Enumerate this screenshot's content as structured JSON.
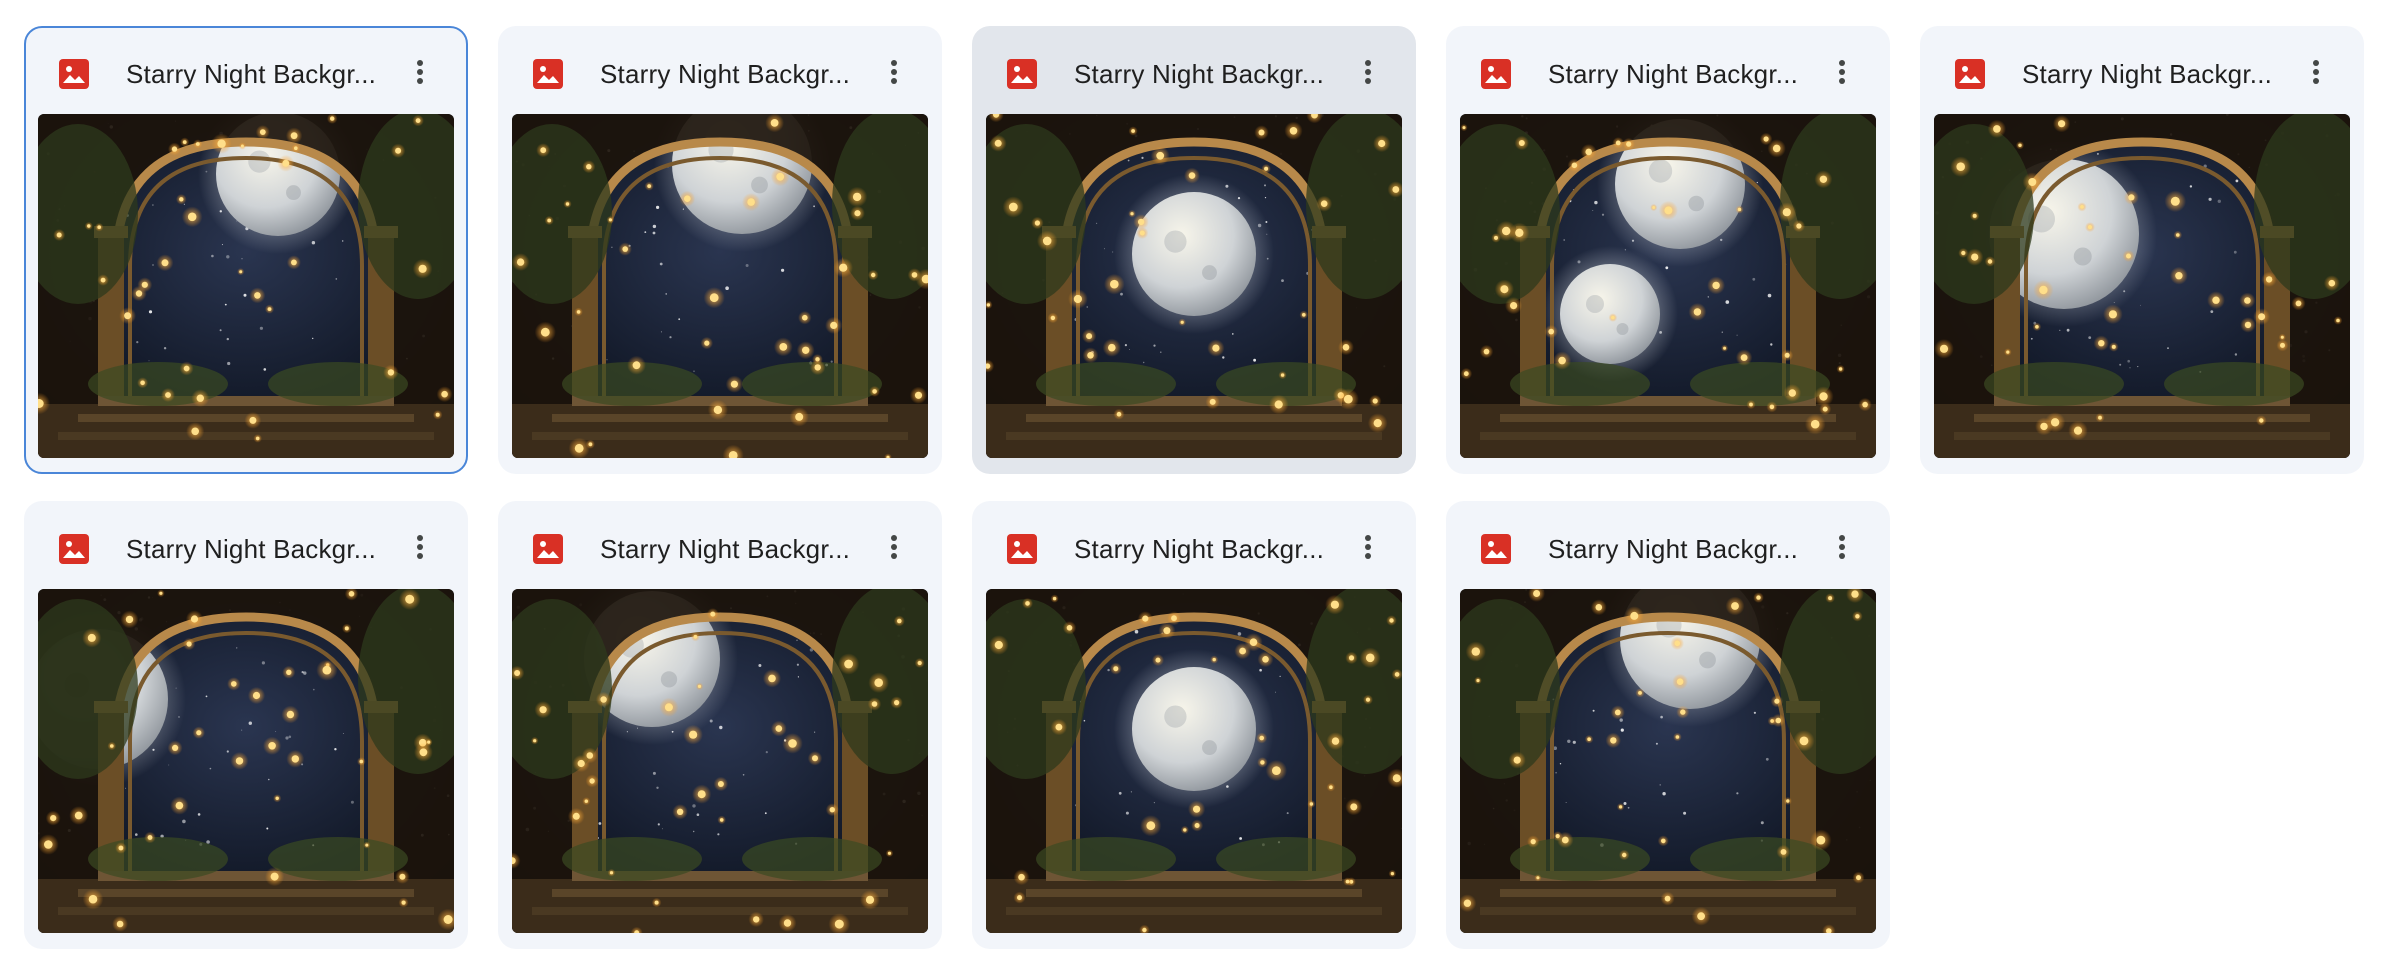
{
  "files": [
    {
      "title": "Starry Night Backgr...",
      "file_type_icon": "image-icon",
      "menu_icon": "more-vert-icon",
      "state": "selected",
      "moon": "upper-center"
    },
    {
      "title": "Starry Night Backgr...",
      "file_type_icon": "image-icon",
      "menu_icon": "more-vert-icon",
      "state": "normal",
      "moon": "upper-right"
    },
    {
      "title": "Starry Night Backgr...",
      "file_type_icon": "image-icon",
      "menu_icon": "more-vert-icon",
      "state": "hovered",
      "moon": "center"
    },
    {
      "title": "Starry Night Backgr...",
      "file_type_icon": "image-icon",
      "menu_icon": "more-vert-icon",
      "state": "normal",
      "moon": "two-moons"
    },
    {
      "title": "Starry Night Backgr...",
      "file_type_icon": "image-icon",
      "menu_icon": "more-vert-icon",
      "state": "normal",
      "moon": "center-left"
    },
    {
      "title": "Starry Night Backgr...",
      "file_type_icon": "image-icon",
      "menu_icon": "more-vert-icon",
      "state": "normal",
      "moon": "left"
    },
    {
      "title": "Starry Night Backgr...",
      "file_type_icon": "image-icon",
      "menu_icon": "more-vert-icon",
      "state": "normal",
      "moon": "upper-left"
    },
    {
      "title": "Starry Night Backgr...",
      "file_type_icon": "image-icon",
      "menu_icon": "more-vert-icon",
      "state": "normal",
      "moon": "center"
    },
    {
      "title": "Starry Night Backgr...",
      "file_type_icon": "image-icon",
      "menu_icon": "more-vert-icon",
      "state": "normal",
      "moon": "upper-right"
    }
  ],
  "colors": {
    "image_icon": "#d93025",
    "selected_border": "#4a86d8",
    "card_bg": "#f2f5fa",
    "card_hover_bg": "#e2e6ec"
  }
}
